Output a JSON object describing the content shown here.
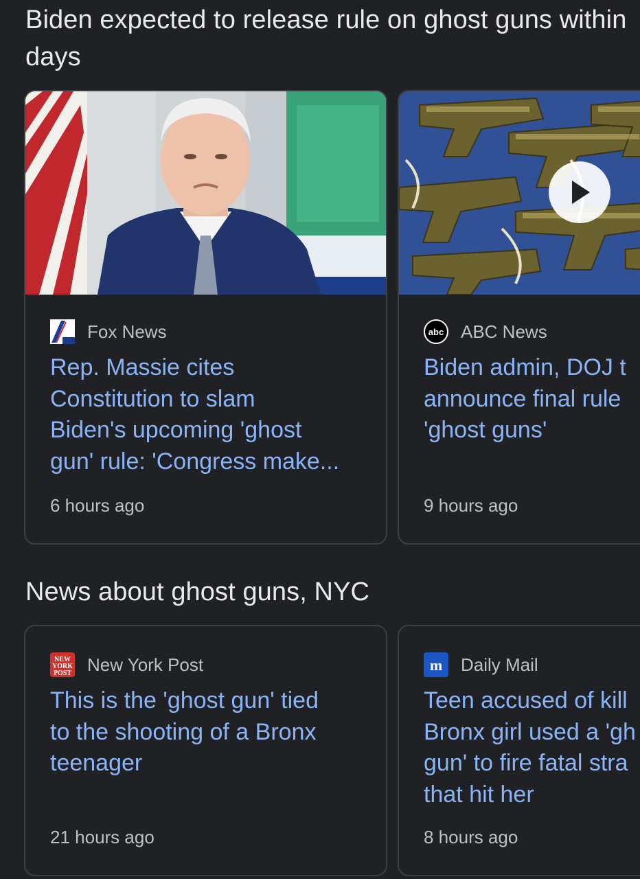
{
  "sections": [
    {
      "title": "Biden expected to release rule on ghost guns within days",
      "cards": [
        {
          "source": "Fox News",
          "headline_lines": [
            "Rep. Massie cites",
            "Constitution to slam",
            "Biden's upcoming 'ghost",
            "gun' rule: 'Congress make..."
          ],
          "time": "6 hours ago",
          "logo_icon": "fox-news-logo-icon"
        },
        {
          "source": "ABC News",
          "headline_lines": [
            "Biden admin, DOJ t",
            "announce final rule",
            "'ghost guns'"
          ],
          "time": "9 hours ago",
          "logo_icon": "abc-news-logo-icon",
          "has_video": true
        }
      ]
    },
    {
      "title": "News about ghost guns, NYC",
      "cards": [
        {
          "source": "New York Post",
          "headline_lines": [
            "This is the 'ghost gun' tied",
            "to the shooting of a Bronx",
            "teenager"
          ],
          "time": "21 hours ago",
          "logo_icon": "new-york-post-logo-icon"
        },
        {
          "source": "Daily Mail",
          "headline_lines": [
            "Teen accused of kill",
            "Bronx girl used a 'gh",
            "gun' to fire fatal stra",
            "that hit her"
          ],
          "time": "8 hours ago",
          "logo_icon": "daily-mail-logo-icon"
        }
      ]
    }
  ],
  "colors": {
    "background": "#202124",
    "headline": "#8ab4f8",
    "title": "#e8eaed",
    "meta": "#bdc1c6",
    "card_border": "#3c4043"
  }
}
